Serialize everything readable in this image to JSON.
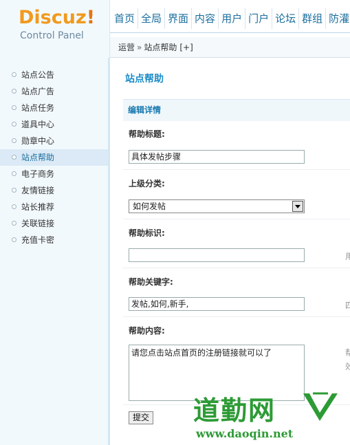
{
  "logo": {
    "main": "Discuz",
    "bang": "!",
    "sub": "Control Panel"
  },
  "top_nav": [
    "首页",
    "全局",
    "界面",
    "内容",
    "用户",
    "门户",
    "论坛",
    "群组",
    "防灌"
  ],
  "breadcrumb": {
    "parent": "运营",
    "separator": "»",
    "current": "站点帮助",
    "add": "[+]"
  },
  "sidebar": {
    "items": [
      {
        "label": "站点公告",
        "active": false
      },
      {
        "label": "站点广告",
        "active": false
      },
      {
        "label": "站点任务",
        "active": false
      },
      {
        "label": "道具中心",
        "active": false
      },
      {
        "label": "勋章中心",
        "active": false
      },
      {
        "label": "站点帮助",
        "active": true
      },
      {
        "label": "电子商务",
        "active": false
      },
      {
        "label": "友情链接",
        "active": false
      },
      {
        "label": "站长推荐",
        "active": false
      },
      {
        "label": "关联链接",
        "active": false
      },
      {
        "label": "充值卡密",
        "active": false
      }
    ]
  },
  "main": {
    "title": "站点帮助",
    "section": "编辑详情",
    "fields": {
      "title_label": "帮助标题:",
      "title_value": "具体发帖步骤",
      "parent_label": "上级分类:",
      "parent_value": "如何发帖",
      "ident_label": "帮助标识:",
      "ident_value": "",
      "ident_tip": "用",
      "keywords_label": "帮助关键字:",
      "keywords_value": "发帖,如何,新手,",
      "keywords_tip": "四",
      "content_label": "帮助内容:",
      "content_value": "请您点击站点首页的注册链接就可以了",
      "content_tip_1": "帮",
      "content_tip_2": "效"
    },
    "submit_label": "提交"
  },
  "watermark": {
    "cn": "道勤网",
    "url": "www.daoqin.net",
    "color": "#2d9b35"
  }
}
